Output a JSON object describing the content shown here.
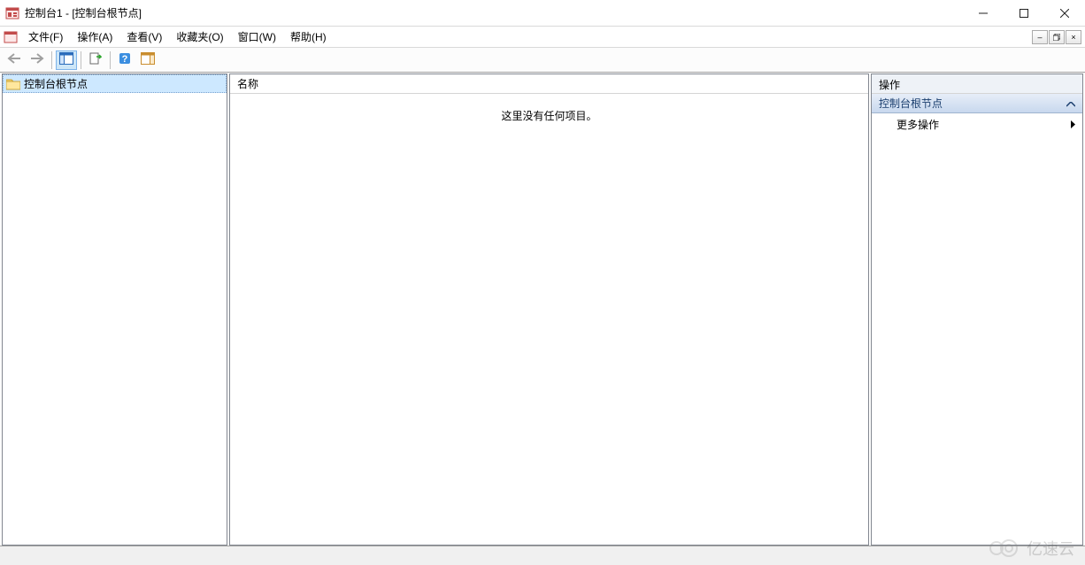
{
  "window": {
    "title": "控制台1 - [控制台根节点]"
  },
  "menu": {
    "file": "文件(F)",
    "action": "操作(A)",
    "view": "查看(V)",
    "favorites": "收藏夹(O)",
    "window": "窗口(W)",
    "help": "帮助(H)"
  },
  "tree": {
    "root_label": "控制台根节点"
  },
  "list": {
    "column_name": "名称",
    "empty_text": "这里没有任何项目。"
  },
  "actions": {
    "header": "操作",
    "group_label": "控制台根节点",
    "more_actions": "更多操作"
  },
  "watermark": "亿速云"
}
